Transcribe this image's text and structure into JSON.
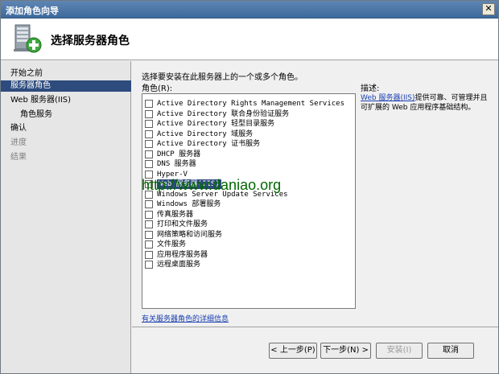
{
  "window": {
    "title": "添加角色向导",
    "close_glyph": "✕"
  },
  "header": {
    "title": "选择服务器角色",
    "icon": "server-roles-wizard-icon"
  },
  "sidebar": {
    "items": [
      {
        "label": "开始之前",
        "state": "normal"
      },
      {
        "label": "服务器角色",
        "state": "active"
      },
      {
        "label": "Web 服务器(IIS)",
        "state": "normal"
      },
      {
        "label": "角色服务",
        "state": "sub"
      },
      {
        "label": "确认",
        "state": "normal"
      },
      {
        "label": "进度",
        "state": "disabled"
      },
      {
        "label": "结果",
        "state": "disabled"
      }
    ]
  },
  "main": {
    "instruction": "选择要安装在此服务器上的一个或多个角色。",
    "roles_label": "角色(R):",
    "roles": [
      {
        "label": "Active Directory Rights Management Services",
        "checked": false
      },
      {
        "label": "Active Directory 联合身份验证服务",
        "checked": false
      },
      {
        "label": "Active Directory 轻型目录服务",
        "checked": false
      },
      {
        "label": "Active Directory 域服务",
        "checked": false
      },
      {
        "label": "Active Directory 证书服务",
        "checked": false
      },
      {
        "label": "DHCP 服务器",
        "checked": false
      },
      {
        "label": "DNS 服务器",
        "checked": false
      },
      {
        "label": "Hyper-V",
        "checked": false
      },
      {
        "label": "Web 服务器(IIS)",
        "checked": true
      },
      {
        "label": "Windows Server Update Services",
        "checked": false
      },
      {
        "label": "Windows 部署服务",
        "checked": false
      },
      {
        "label": "传真服务器",
        "checked": false
      },
      {
        "label": "打印和文件服务",
        "checked": false
      },
      {
        "label": "网络策略和访问服务",
        "checked": false
      },
      {
        "label": "文件服务",
        "checked": false
      },
      {
        "label": "应用程序服务器",
        "checked": false
      },
      {
        "label": "远程桌面服务",
        "checked": false
      }
    ],
    "check_glyph": "✓",
    "description": {
      "label": "描述:",
      "link": "Web 服务器(IIS)",
      "text": "提供可靠、可管理并且可扩展的 Web 应用程序基础结构。"
    },
    "more_info_link": "有关服务器角色的详细信息"
  },
  "buttons": {
    "prev": "< 上一步(P)",
    "next": "下一步(N) >",
    "install": "安装(I)",
    "cancel": "取消"
  },
  "watermark": "http://www.daniao.org"
}
